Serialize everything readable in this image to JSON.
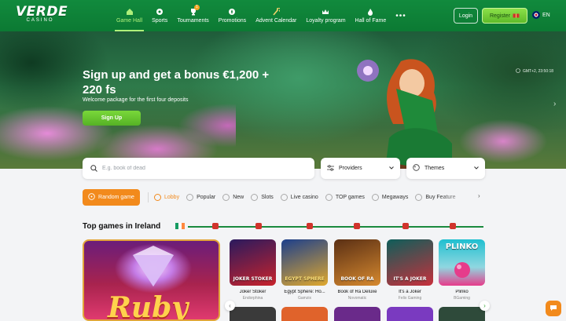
{
  "brand": {
    "name": "VERDE",
    "sub": "CASINO"
  },
  "nav": [
    {
      "label": "Game Hall",
      "icon": "house-icon",
      "active": true
    },
    {
      "label": "Sports",
      "icon": "soccer-ball-icon"
    },
    {
      "label": "Tournaments",
      "icon": "trophy-icon",
      "badge": "1"
    },
    {
      "label": "Promotions",
      "icon": "gift-icon"
    },
    {
      "label": "Advent Calendar",
      "icon": "candy-icon"
    },
    {
      "label": "Loyalty program",
      "icon": "crown-icon"
    },
    {
      "label": "Hall of Fame",
      "icon": "flame-icon"
    }
  ],
  "nav_more": "•••",
  "header": {
    "login": "Login",
    "register": "Register",
    "lang": "EN"
  },
  "hero": {
    "title": "Sign up and get a bonus €1,200 + 220 fs",
    "subtitle": "Welcome package for the first four deposits",
    "cta": "Sign Up",
    "meta": "GMT+2, 23:50:18",
    "next": "›"
  },
  "search": {
    "placeholder": "E.g. book of dead"
  },
  "filters": {
    "providers": "Providers",
    "themes": "Themes"
  },
  "random_game": "Random game",
  "categories": [
    {
      "label": "Lobby",
      "active": true
    },
    {
      "label": "Popular"
    },
    {
      "label": "New"
    },
    {
      "label": "Slots"
    },
    {
      "label": "Live casino"
    },
    {
      "label": "TOP games"
    },
    {
      "label": "Megaways"
    },
    {
      "label": "Buy Feature"
    }
  ],
  "categories_next": "›",
  "section_title": "Top games in Ireland",
  "featured": {
    "art_text": "Ruby"
  },
  "games": [
    {
      "name": "Joker Stoker",
      "provider": "Endorphina",
      "art_text": "JOKER STOKER",
      "c1": "#2a1a5e",
      "c2": "#c8232c"
    },
    {
      "name": "Egypt Sphere: Ho...",
      "provider": "Gamzix",
      "art_text": "EGYPT SPHERE",
      "c1": "#1c3f8c",
      "c2": "#e0a82e"
    },
    {
      "name": "Book of Ra Deluxe",
      "provider": "Novomatic",
      "art_text": "BOOK OF RA",
      "c1": "#5a2f14",
      "c2": "#d6892f"
    },
    {
      "name": "It's a Joker",
      "provider": "Felix Gaming",
      "art_text": "IT'S A JOKER",
      "c1": "#0e5e5a",
      "c2": "#c7303c"
    },
    {
      "name": "Plinko",
      "provider": "BGaming",
      "art_text": "PLINKO",
      "c1": "#1fbfd0",
      "c2": "#e63c8b"
    }
  ],
  "games_prev": "‹",
  "games_next": "›",
  "colors": {
    "brand_green": "#0c7a33",
    "accent_orange": "#f28a1c",
    "register_green": "#6cc832"
  }
}
